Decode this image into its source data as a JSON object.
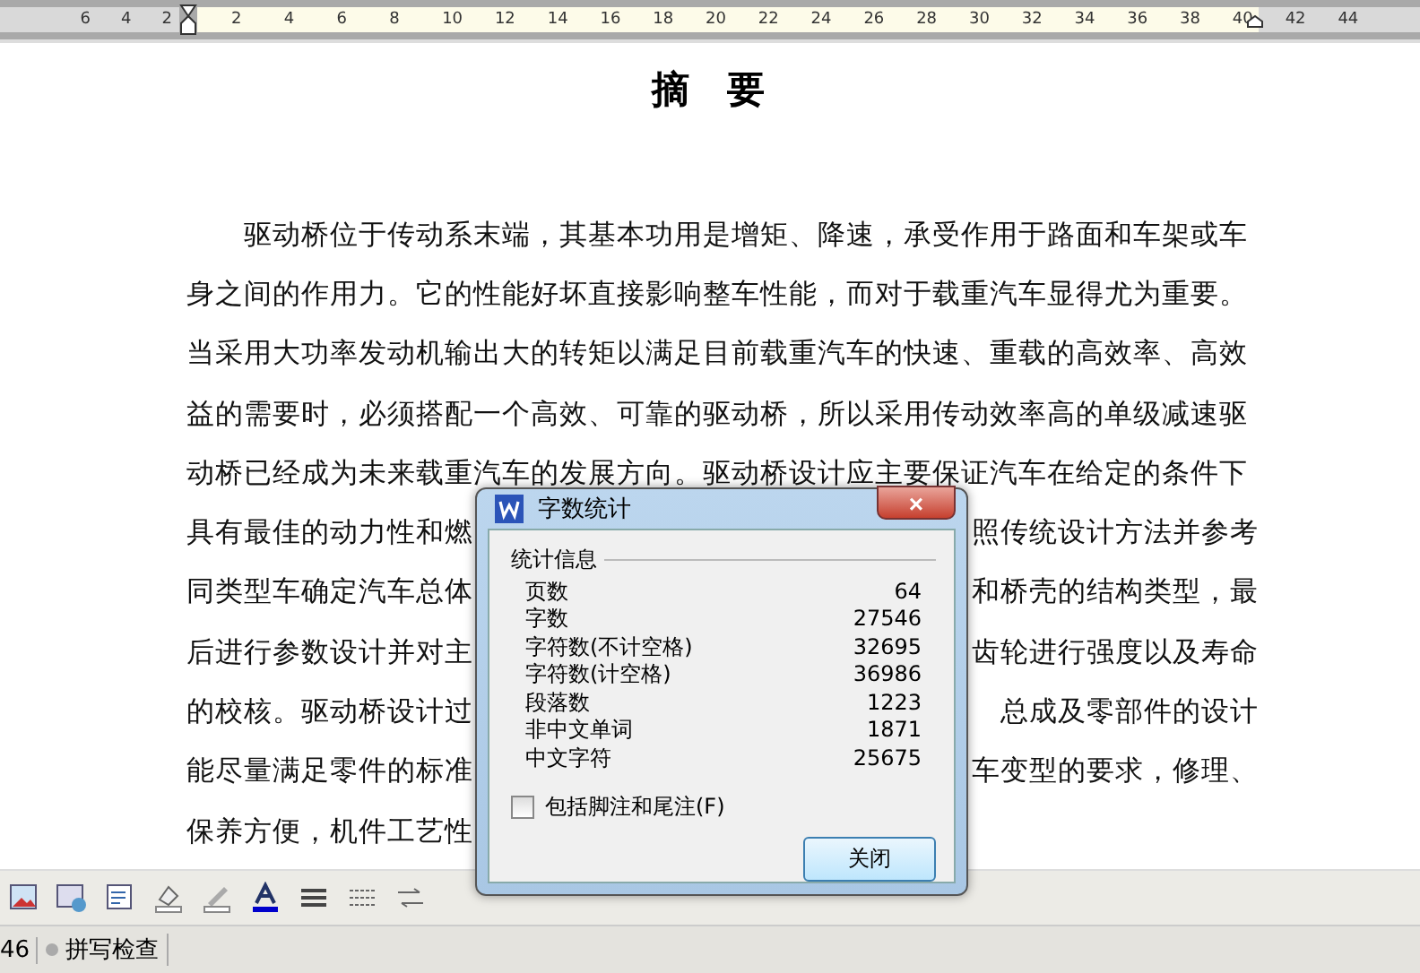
{
  "ruler": {
    "left_labels": [
      "6",
      "4",
      "2"
    ],
    "labels": [
      "2",
      "4",
      "6",
      "8",
      "10",
      "12",
      "14",
      "16",
      "18",
      "20",
      "22",
      "24",
      "26",
      "28",
      "30",
      "32",
      "34",
      "36",
      "38",
      "40",
      "42",
      "44"
    ]
  },
  "document": {
    "title": "摘  要",
    "paragraphs": [
      {
        "lines": [
          {
            "left": "驱动桥位于传动系末端，其基本功用是增矩、降速，承受作用于路面和车架或车"
          },
          {
            "left": "身之间的作用力。它的性能好坏直接影响整车性能，而对于载重汽车显得尤为重要。"
          },
          {
            "left": "当采用大功率发动机输出大的转矩以满足目前载重汽车的快速、重载的高效率、高效"
          },
          {
            "left": "益的需要时，必须搭配一个高效、可靠的驱动桥，所以采用传动效率高的单级减速驱"
          },
          {
            "left": "动桥已经成为未来载重汽车的发展方向。驱动桥设计应主要保证汽车在给定的条件下"
          },
          {
            "left": "具有最佳的动力性和燃",
            "right": "照传统设计方法并参考"
          },
          {
            "left": "同类型车确定汽车总体",
            "right": "和桥壳的结构类型，最"
          },
          {
            "left": "后进行参数设计并对主",
            "right": "齿轮进行强度以及寿命"
          },
          {
            "left": "的校核。驱动桥设计过",
            "right": "总成及零部件的设计"
          },
          {
            "left": "能尽量满足零件的标准",
            "right": "车变型的要求，修理、"
          },
          {
            "left": "保养方便，机件工艺性"
          }
        ]
      }
    ]
  },
  "dialog": {
    "title": "字数统计",
    "close": "×",
    "group": "统计信息",
    "stats": [
      {
        "label": "页数",
        "value": "64"
      },
      {
        "label": "字数",
        "value": "27546"
      },
      {
        "label": "字符数(不计空格)",
        "value": "32695"
      },
      {
        "label": "字符数(计空格)",
        "value": "36986"
      },
      {
        "label": "段落数",
        "value": "1223"
      },
      {
        "label": "非中文单词",
        "value": "1871"
      },
      {
        "label": "中文字符",
        "value": "25675"
      }
    ],
    "checkbox": {
      "label": "包括脚注和尾注(F)",
      "checked": false
    },
    "button": "关闭"
  },
  "status_bar": {
    "page": "46",
    "spell_check": "拼写检查"
  }
}
